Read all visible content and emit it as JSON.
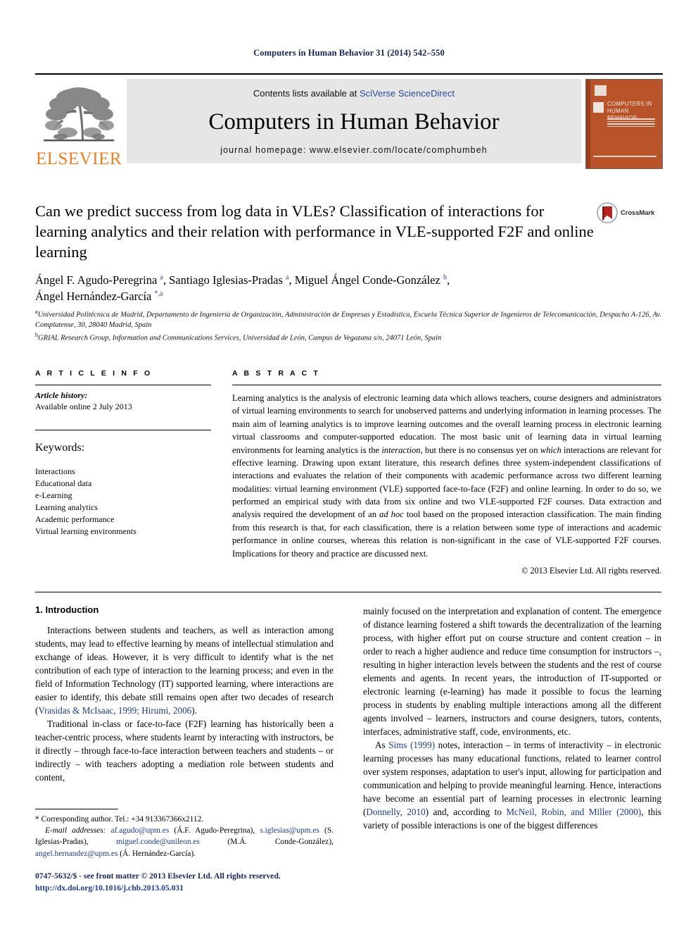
{
  "running_head": "Computers in Human Behavior 31 (2014) 542–550",
  "masthead": {
    "publisher_logo_text": "ELSEVIER",
    "contents_prefix": "Contents lists available at ",
    "contents_link": "SciVerse ScienceDirect",
    "journal_title": "Computers in Human Behavior",
    "homepage_line": "journal homepage: www.elsevier.com/locate/comphumbeh",
    "cover": {
      "title_line1": "Computers in",
      "title_line2": "Human Behavior"
    }
  },
  "crossmark": {
    "label": "CrossMark"
  },
  "article": {
    "title": "Can we predict success from log data in VLEs? Classification of interactions for learning analytics and their relation with performance in VLE-supported F2F and online learning",
    "authors_line1_a": "Ángel F. Agudo-Peregrina ",
    "authors_sup_a1": "a",
    "authors_line1_b": ", Santiago Iglesias-Pradas ",
    "authors_sup_a2": "a",
    "authors_line1_c": ", Miguel Ángel Conde-González ",
    "authors_sup_b": "b",
    "authors_line1_d": ",",
    "authors_line2": "Ángel Hernández-García ",
    "authors_line2_sup": "*,a",
    "affiliation_a_marker": "a",
    "affiliation_a": "Universidad Politécnica de Madrid, Departamento de Ingeniería de Organización, Administración de Empresas y Estadística, Escuela Técnica Superior de Ingenieros de Telecomunicación, Despacho A-126, Av. Complutense, 30, 28040 Madrid, Spain",
    "affiliation_b_marker": "b",
    "affiliation_b": "GRIAL Research Group, Information and Communications Services, Universidad de León, Campus de Vegazana s/n, 24071 León, Spain"
  },
  "article_info": {
    "heading": "A R T I C L E   I N F O",
    "history_label": "Article history:",
    "history_value": "Available online 2 July 2013",
    "keywords_label": "Keywords:",
    "keywords": [
      "Interactions",
      "Educational data",
      "e-Learning",
      "Learning analytics",
      "Academic performance",
      "Virtual learning environments"
    ]
  },
  "abstract": {
    "heading": "A B S T R A C T",
    "part1": "Learning analytics is the analysis of electronic learning data which allows teachers, course designers and administrators of virtual learning environments to search for unobserved patterns and underlying information in learning processes. The main aim of learning analytics is to improve learning outcomes and the overall learning process in electronic learning virtual classrooms and computer-supported education. The most basic unit of learning data in virtual learning environments for learning analytics is the ",
    "em1": "interaction",
    "part2": ", but there is no consensus yet on ",
    "em2": "which",
    "part3": " interactions are relevant for effective learning. Drawing upon extant literature, this research defines three system-independent classifications of interactions and evaluates the relation of their components with academic performance across two different learning modalities: virtual learning environment (VLE) supported face-to-face (F2F) and online learning. In order to do so, we performed an empirical study with data from six online and two VLE-supported F2F courses. Data extraction and analysis required the development of an ",
    "em3": "ad hoc",
    "part4": " tool based on the proposed interaction classification. The main finding from this research is that, for each classification, there is a relation between some type of interactions and academic performance in online courses, whereas this relation is non-significant in the case of VLE-supported F2F courses. Implications for theory and practice are discussed next.",
    "copyright": "© 2013 Elsevier Ltd. All rights reserved."
  },
  "body": {
    "section_heading": "1. Introduction",
    "left_p1_a": "Interactions between students and teachers, as well as interaction among students, may lead to effective learning by means of intellectual stimulation and exchange of ideas. However, it is very difficult to identify what is the net contribution of each type of interaction to the learning process; and even in the field of Information Technology (IT) supported learning, where interactions are easier to identify, this debate still remains open after two decades of research (",
    "left_p1_cite": "Vrasidas & McIsaac, 1999; Hirumi, 2006",
    "left_p1_b": ").",
    "left_p2": "Traditional in-class or face-to-face (F2F) learning has historically been a teacher-centric process, where students learnt by interacting with instructors, be it directly – through face-to-face interaction between teachers and students – or indirectly – with teachers adopting a mediation role between students and content,",
    "right_p1": "mainly focused on the interpretation and explanation of content. The emergence of distance learning fostered a shift towards the decentralization of the learning process, with higher effort put on course structure and content creation – in order to reach a higher audience and reduce time consumption for instructors –, resulting in higher interaction levels between the students and the rest of course elements and agents. In recent years, the introduction of IT-supported or electronic learning (e-learning) has made it possible to focus the learning process in students by enabling multiple interactions among all the different agents involved – learners, instructors and course designers, tutors, contents, interfaces, administrative staff, code, environments, etc.",
    "right_p2_a": "As ",
    "right_p2_cite1": "Sims (1999)",
    "right_p2_b": " notes, interaction – in terms of interactivity – in electronic learning processes has many educational functions, related to learner control over system responses, adaptation to user's input, allowing for participation and communication and helping to provide meaningful learning. Hence, interactions have become an essential part of learning processes in electronic learning (",
    "right_p2_cite2": "Donnelly, 2010",
    "right_p2_c": ") and, according to ",
    "right_p2_cite3": "McNeil, Robin, and Miller (2000)",
    "right_p2_d": ", this variety of possible interactions is one of the biggest differences"
  },
  "footnotes": {
    "corresponding_marker": "*",
    "corresponding_text": " Corresponding author. Tel.: +34 913367366x2112.",
    "email_label": "E-mail addresses:",
    "email_1": "af.agudo@upm.es",
    "email_1_owner": " (Á.F. Agudo-Peregrina), ",
    "email_2": "s.iglesias@upm.es",
    "email_2_owner": " (S. Iglesias-Pradas), ",
    "email_3": "miguel.conde@unileon.es",
    "email_3_owner": " (M.Á. Conde-González), ",
    "email_4": "angel.hernandez@upm.es",
    "email_4_owner": " (Á. Hernández-García)."
  },
  "imprint": {
    "issn_line": "0747-5632/$ - see front matter © 2013 Elsevier Ltd. All rights reserved.",
    "doi_line": "http://dx.doi.org/10.1016/j.chb.2013.05.031"
  },
  "colors": {
    "running_head": "#15255c",
    "elsevier_orange": "#ef7d22",
    "link_blue": "#1b3c8c",
    "band_gray": "#e6e6e6",
    "cover_orange": "#b8532a",
    "crossmark_red": "#b4251f"
  }
}
